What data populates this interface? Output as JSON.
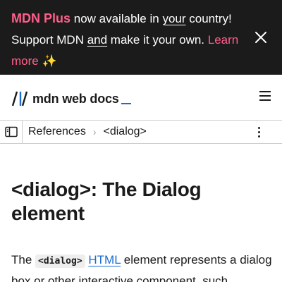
{
  "banner": {
    "brand": "MDN Plus",
    "text_1": " now available in ",
    "your_link": "your",
    "text_2": " country!",
    "text_3": "Support MDN ",
    "and_link": "and",
    "text_4": " make it your own. ",
    "learn_more": "Learn more ✨",
    "close_icon": "close-icon"
  },
  "header": {
    "logo_text": "mdn web docs",
    "menu_icon": "hamburger-menu-icon"
  },
  "breadcrumb": {
    "items": [
      "References",
      "<dialog>"
    ],
    "separator": "›",
    "sidebar_icon": "sidebar-toggle-icon",
    "more_icon": "more-options-icon"
  },
  "main": {
    "title": "<dialog>: The Dialog element",
    "para_1": "The ",
    "code": "<dialog>",
    "link": "HTML",
    "para_2": " element represents a dialog box or other interactive component, such"
  },
  "colors": {
    "banner_bg": "#1b1b1b",
    "brand_pink": "#ff5f8a",
    "link_blue": "#1b6bd3"
  }
}
